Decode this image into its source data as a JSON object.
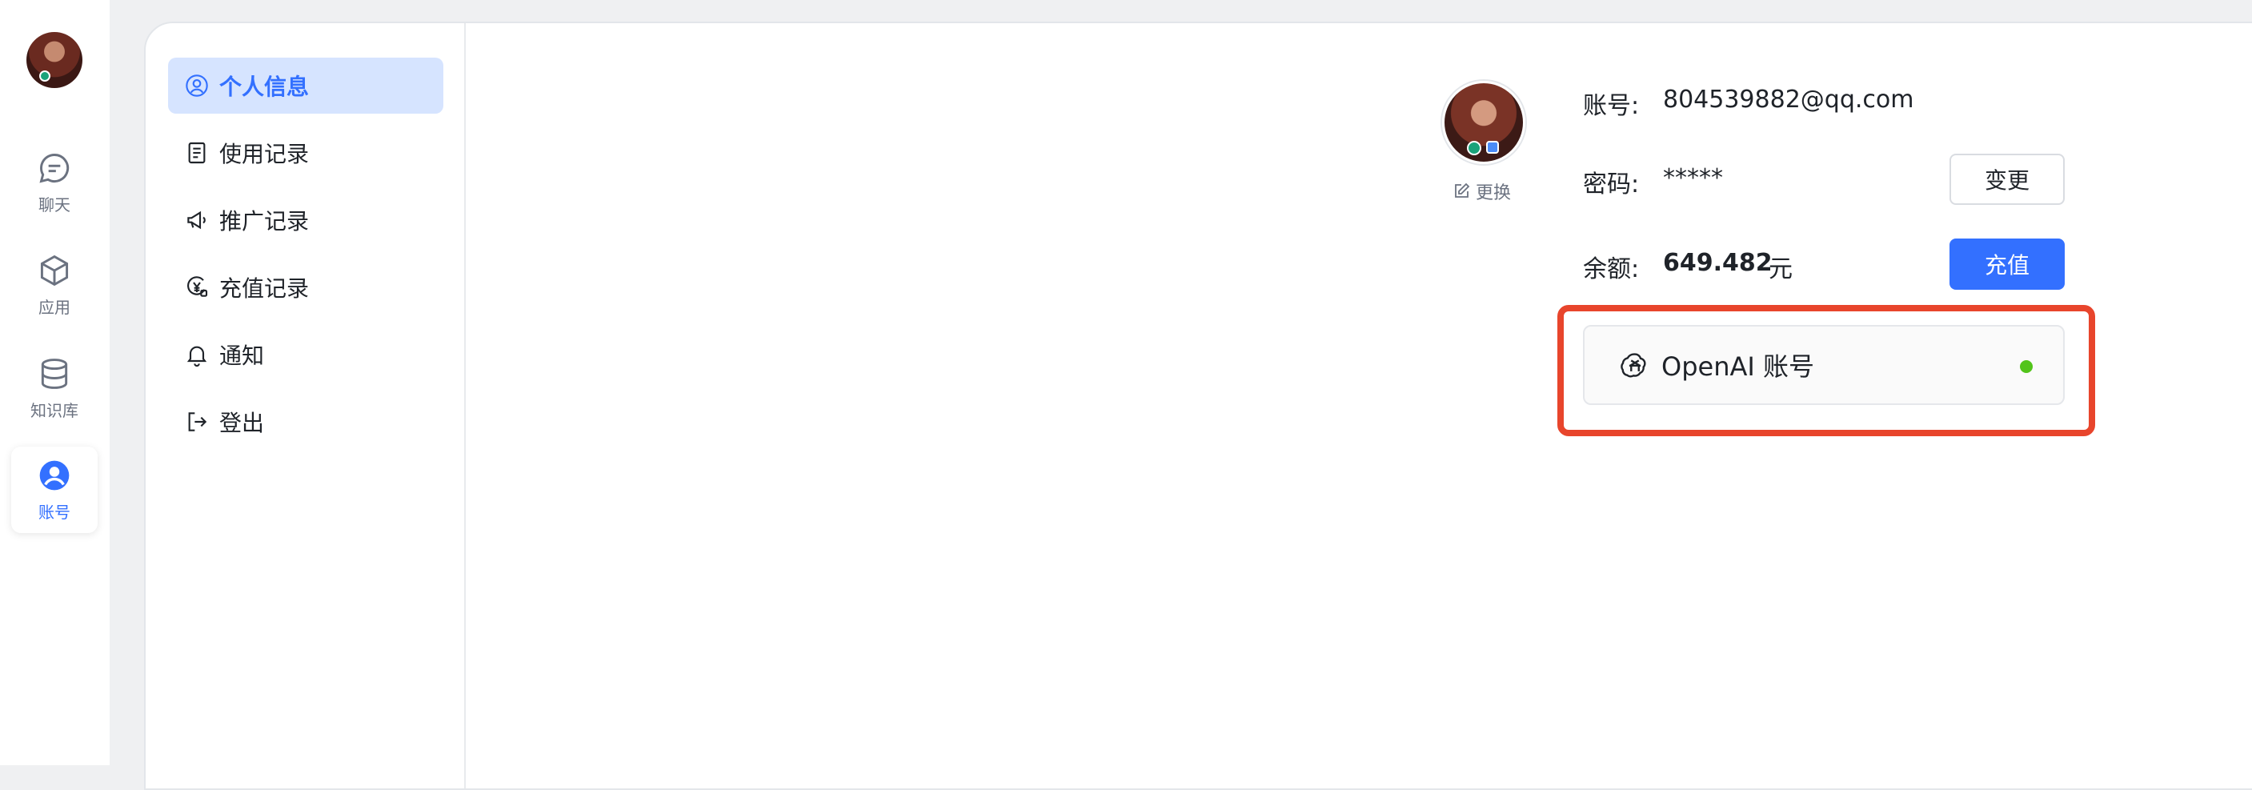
{
  "rail": {
    "items": [
      {
        "label": "聊天",
        "icon": "chat-icon"
      },
      {
        "label": "应用",
        "icon": "cube-icon"
      },
      {
        "label": "知识库",
        "icon": "database-icon"
      },
      {
        "label": "账号",
        "icon": "user-icon"
      }
    ],
    "active_index": 3
  },
  "subnav": {
    "items": [
      {
        "label": "个人信息",
        "icon": "user-circle-icon"
      },
      {
        "label": "使用记录",
        "icon": "document-icon"
      },
      {
        "label": "推广记录",
        "icon": "megaphone-icon"
      },
      {
        "label": "充值记录",
        "icon": "yuan-coin-icon"
      },
      {
        "label": "通知",
        "icon": "bell-icon"
      },
      {
        "label": "登出",
        "icon": "logout-icon"
      }
    ],
    "active_index": 0
  },
  "profile": {
    "change_avatar_label": "更换",
    "account_label": "账号:",
    "account_value": "804539882@qq.com",
    "password_label": "密码:",
    "password_value": "*****",
    "change_button": "变更",
    "balance_label": "余额:",
    "balance_value": "649.482",
    "balance_unit": "元",
    "recharge_button": "充值"
  },
  "openai": {
    "label": "OpenAI 账号",
    "status_color": "#52c41a"
  },
  "colors": {
    "accent": "#3370ff",
    "highlight": "#e8452c"
  }
}
